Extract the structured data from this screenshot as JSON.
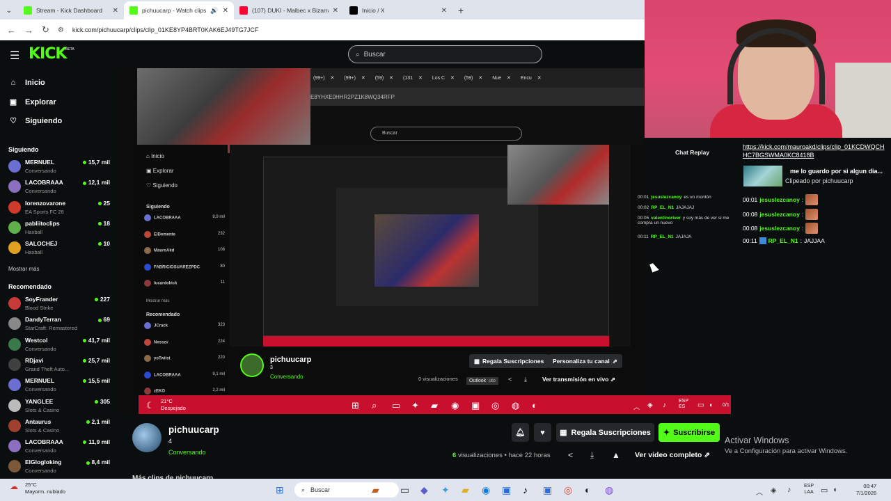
{
  "browser": {
    "tabs": [
      {
        "title": "Stream - Kick Dashboard",
        "favicon_color": "#53fc18"
      },
      {
        "title": "pichuucarp - Watch clips on",
        "favicon_color": "#53fc18",
        "active": true
      },
      {
        "title": "(107) DUKI - Malbec x Bizarrap",
        "favicon_color": "#ff0033"
      },
      {
        "title": "Inicio / X",
        "favicon_color": "#000000"
      }
    ],
    "url": "kick.com/pichuucarp/clips/clip_01KE8YP4BRT0KAK6EJ49TG7JCF"
  },
  "header": {
    "logo": "KICK",
    "beta": "BETA",
    "search_placeholder": "Buscar"
  },
  "sidebar": {
    "nav": [
      {
        "label": "Inicio",
        "icon": "home-icon"
      },
      {
        "label": "Explorar",
        "icon": "compass-icon"
      },
      {
        "label": "Siguiendo",
        "icon": "heart-icon"
      }
    ],
    "following_title": "Siguiendo",
    "following": [
      {
        "name": "MERNUEL",
        "category": "Conversando",
        "viewers": "15,7 mil",
        "color": "#6a6fd0"
      },
      {
        "name": "LACOBRAAA",
        "category": "Conversando",
        "viewers": "12,1 mil",
        "color": "#8c6fc0"
      },
      {
        "name": "lorenzovarone",
        "category": "EA Sports FC 26",
        "viewers": "25",
        "color": "#d03a2a"
      },
      {
        "name": "pabliitoclips",
        "category": "Haxball",
        "viewers": "18",
        "color": "#5fb04a"
      },
      {
        "name": "SALOCHEJ",
        "category": "Haxball",
        "viewers": "10",
        "color": "#e0a020"
      }
    ],
    "show_more": "Mostrar más",
    "recommended_title": "Recomendado",
    "recommended": [
      {
        "name": "SoyFrander",
        "category": "Blood Strike",
        "viewers": "227",
        "color": "#c83a3a"
      },
      {
        "name": "DandyTerran",
        "category": "StarCraft: Remastered",
        "viewers": "69",
        "color": "#888888"
      },
      {
        "name": "Westcol",
        "category": "Conversando",
        "viewers": "41,7 mil",
        "color": "#3a7a4a"
      },
      {
        "name": "RDjavi",
        "category": "Grand Theft Auto...",
        "viewers": "25,7 mil",
        "color": "#404040"
      },
      {
        "name": "MERNUEL",
        "category": "Conversando",
        "viewers": "15,5 mil",
        "color": "#6a6fd0"
      },
      {
        "name": "YANGLEE",
        "category": "Slots & Casino",
        "viewers": "305",
        "color": "#bbbbbb"
      },
      {
        "name": "Antaurus",
        "category": "Slots & Casino",
        "viewers": "2,1 mil",
        "color": "#a04030"
      },
      {
        "name": "LACOBRAAA",
        "category": "Conversando",
        "viewers": "11,9 mil",
        "color": "#8c6fc0"
      },
      {
        "name": "ElGlogloking",
        "category": "Conversando",
        "viewers": "8,4 mil",
        "color": "#7a5a3a"
      }
    ]
  },
  "nested": {
    "tabs": [
      "(99+)",
      "(99+)",
      "(59)",
      "(131",
      "Los C",
      "(59)",
      "Nue",
      "Encu"
    ],
    "url_fragment": "E8YHXE0HHR2PZ1K8WQ34RFP",
    "search": "Buscar",
    "nav": [
      "Inicio",
      "Explorar",
      "Siguiendo"
    ],
    "following_title": "Siguiendo",
    "following": [
      {
        "name": "LACOBRAAA",
        "viewers": "8,9 mil"
      },
      {
        "name": "ElDemente",
        "viewers": "232"
      },
      {
        "name": "MauroAkd",
        "viewers": "108"
      },
      {
        "name": "FABRICIOSUAREZPDC",
        "viewers": "80"
      },
      {
        "name": "lucardokick",
        "viewers": "11"
      }
    ],
    "show_more": "Mostrar más",
    "recommended_title": "Recomendado",
    "recommended": [
      {
        "name": "JCrack",
        "viewers": "323"
      },
      {
        "name": "Nesszv",
        "viewers": "224"
      },
      {
        "name": "yoTwiist",
        "viewers": "220"
      },
      {
        "name": "LACOBRAAA",
        "viewers": "9,1 mil"
      },
      {
        "name": "zEKO",
        "viewers": "2,2 mil"
      }
    ],
    "chat_title": "Chat Replay",
    "chat": [
      {
        "time": "00:01",
        "user": "jesuslezcanoy",
        "text": "es un montón"
      },
      {
        "time": "00:02",
        "user": "RP_EL_N1",
        "text": "JAJAJAJ"
      },
      {
        "time": "00:05",
        "user": "valentinoriver",
        "text": "y soy más de ver si me compra un nuevo"
      },
      {
        "time": "00:11",
        "user": "RP_EL_N1",
        "text": "JAJAJA"
      }
    ],
    "channel_name": "pichuucarp",
    "channel_sub": "3",
    "channel_cat": "Conversando",
    "gift_label": "Regala Suscripciones",
    "personalize_label": "Personaliza tu canal",
    "views": "0 visualizaciones",
    "tooltip": "Outlook",
    "tooltip_tail": "uto",
    "watch_live": "Ver transmisión en vivo",
    "weather_temp": "21°C",
    "weather_desc": "Despejado",
    "lang1": "ESP",
    "lang2": "ES",
    "time": "0/1"
  },
  "chat": {
    "clip_link": "https://kick.com/mauroakd/clips/clip_01KCDWQCHHC7BGSWMA0KC8418B",
    "clip_title": "me lo guardo por si algun dia...",
    "clip_by": "Clipeado por pichuucarp",
    "messages": [
      {
        "time": "00:01",
        "user": "jesuslezcanoy",
        "text": ""
      },
      {
        "time": "00:08",
        "user": "jesuslezcanoy",
        "text": ""
      },
      {
        "time": "00:08",
        "user": "jesuslezcanoy",
        "text": ""
      },
      {
        "time": "00:11",
        "user": "RP_EL_N1",
        "text": "JAJJAA"
      }
    ]
  },
  "clip": {
    "channel_name": "pichuucarp",
    "subscribers": "4",
    "category": "Conversando",
    "gift_label": "Regala Suscripciones",
    "subscribe_label": "Suscribirse",
    "views_count": "6",
    "views_label": "visualizaciones",
    "time_ago": "hace 22 horas",
    "full_video_label": "Ver video completo",
    "more_clips": "Más clips de pichuucarp"
  },
  "activate_windows": {
    "title": "Activar Windows",
    "subtitle": "Ve a Configuración para activar Windows."
  },
  "taskbar": {
    "weather_temp": "25°C",
    "weather_desc": "Mayorm. nublado",
    "search_placeholder": "Buscar",
    "lang_line1": "ESP",
    "lang_line2": "LAA",
    "time": "00:47",
    "date": "7/1/2026"
  }
}
